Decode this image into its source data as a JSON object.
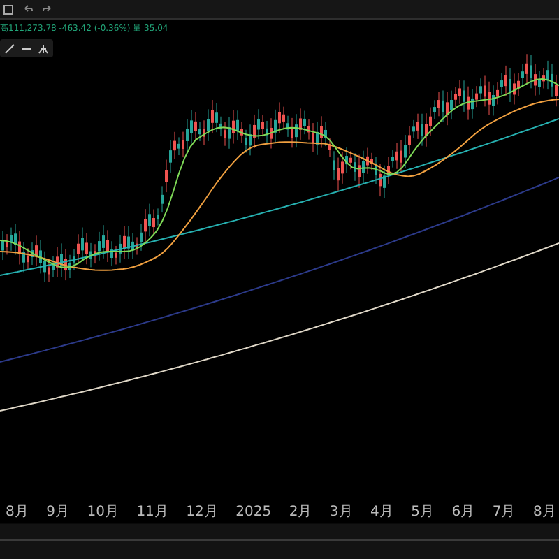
{
  "legend": {
    "text": "高111,273.78 -463.42 (-0.36%) 量 35.04"
  },
  "time_axis": {
    "labels": [
      "8月",
      "9月",
      "10月",
      "11月",
      "12月",
      "2025",
      "2月",
      "3月",
      "4月",
      "5月",
      "6月",
      "7月",
      "8月"
    ]
  }
}
